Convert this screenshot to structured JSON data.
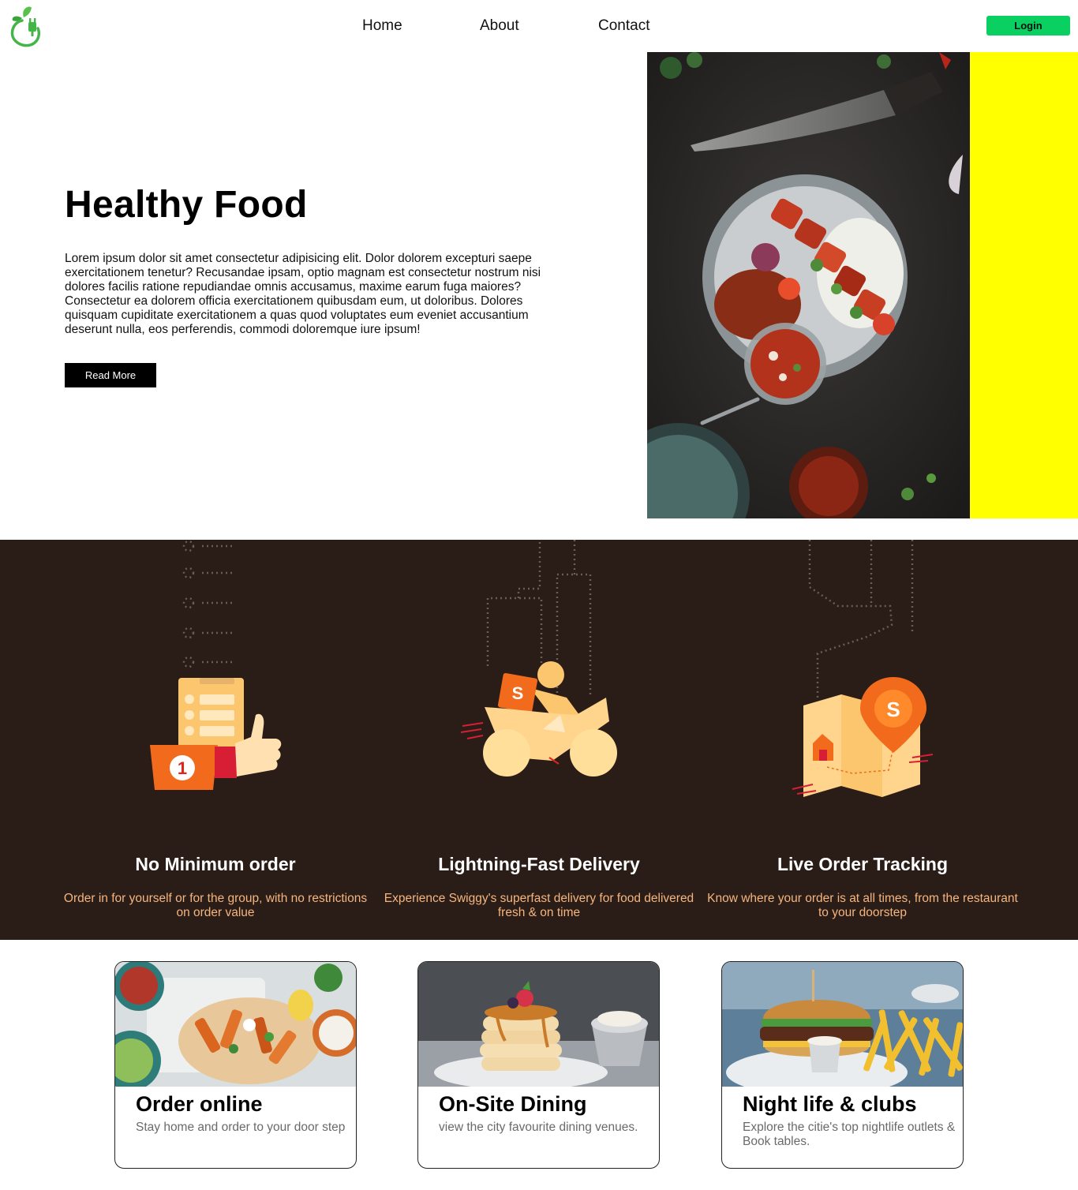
{
  "nav": {
    "logo_icon": "leaf-plug-logo-icon",
    "links": [
      "Home",
      "About",
      "Contact"
    ],
    "login_label": "Login",
    "accent_color": "#09d060"
  },
  "hero": {
    "title": "Healthy Food",
    "text": "Lorem ipsum dolor sit amet consectetur adipisicing elit. Dolor dolorem excepturi saepe exercitationem tenetur? Recusandae ipsam, optio magnam est consectetur nostrum nisi dolores facilis ratione repudiandae omnis accusamus, maxime earum fuga maiores? Consectetur ea dolorem officia exercitationem quibusdam eum, ut doloribus. Dolores quisquam cupiditate exercitationem a quas quod voluptates eum eveniet accusantium deserunt nulla, eos perferendis, commodi doloremque iure ipsum!",
    "button_label": "Read More",
    "side_color": "#ffff00"
  },
  "features": {
    "background": "#2a1d18",
    "items": [
      {
        "title": "No Minimum order",
        "desc": "Order in for yourself or for the group, with no restrictions on order value",
        "icon": "thumbs-up-order-icon"
      },
      {
        "title": "Lightning-Fast Delivery",
        "desc": "Experience Swiggy's superfast delivery for food delivered fresh & on time",
        "icon": "delivery-scooter-icon"
      },
      {
        "title": "Live Order Tracking",
        "desc": "Know where your order is at all times, from the restaurant to your doorstep",
        "icon": "map-pin-tracking-icon"
      }
    ]
  },
  "cards": [
    {
      "title": "Order online",
      "desc": "Stay home and order to your door step"
    },
    {
      "title": "On-Site Dining",
      "desc": "view the city favourite dining venues."
    },
    {
      "title": "Night life & clubs",
      "desc": "Explore the citie's top nightlife outlets & Book tables."
    }
  ]
}
